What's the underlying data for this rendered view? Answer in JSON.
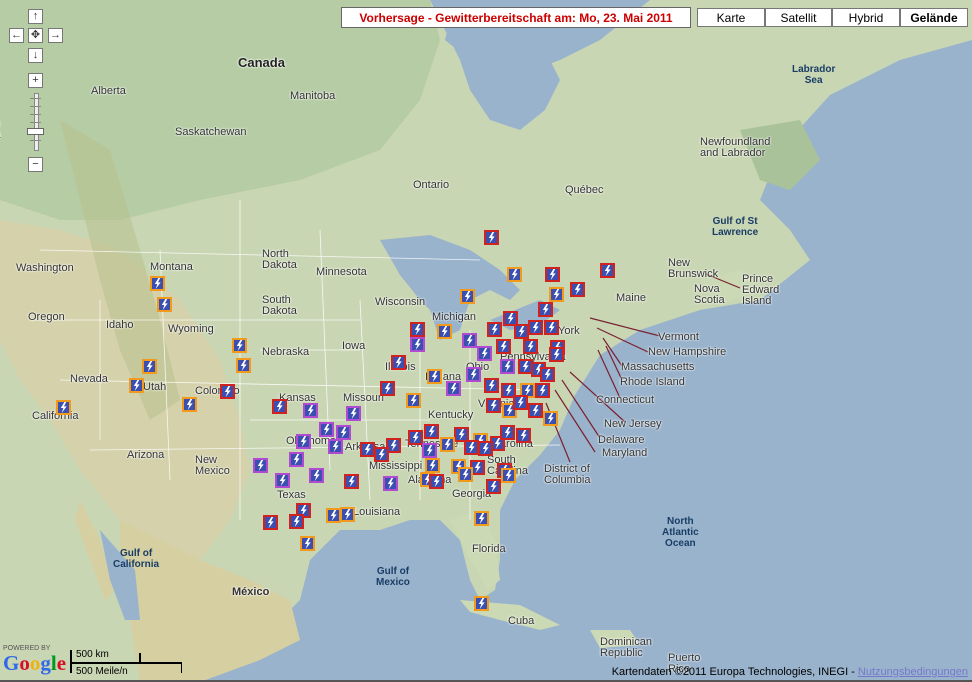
{
  "title": "Vorhersage - Gewitterbereitschaft am: Mo, 23. Mai 2011",
  "map_types": [
    {
      "label": "Karte",
      "active": false
    },
    {
      "label": "Satellit",
      "active": false
    },
    {
      "label": "Hybrid",
      "active": false
    },
    {
      "label": "Gelände",
      "active": true
    }
  ],
  "nav_controls": {
    "pan_up": "↑",
    "pan_left": "←",
    "pan_center": "✥",
    "pan_right": "→",
    "pan_down": "↓",
    "zoom_in": "+",
    "zoom_out": "−"
  },
  "logo": {
    "powered_by": "POWERED BY",
    "letters": [
      "G",
      "o",
      "o",
      "g",
      "l",
      "e"
    ],
    "colors": [
      "#3369e8",
      "#d50f25",
      "#eeb211",
      "#3369e8",
      "#009925",
      "#d50f25"
    ]
  },
  "scale": {
    "metric": "500 km",
    "imperial": "500 Meile/n"
  },
  "attribution": {
    "text": "Kartendaten ©2011 Europa Technologies, INEGI - ",
    "link": "Nutzungsbedingungen"
  },
  "place_labels": [
    {
      "id": "canada",
      "text": "Canada",
      "kind": "big"
    },
    {
      "id": "alberta",
      "text": "Alberta"
    },
    {
      "id": "manitoba",
      "text": "Manitoba"
    },
    {
      "id": "saskatchewan",
      "text": "Saskatchewan"
    },
    {
      "id": "ontario",
      "text": "Ontario"
    },
    {
      "id": "quebec",
      "text": "Québec"
    },
    {
      "id": "labrador-sea",
      "text": "Labrador\nSea",
      "kind": "water"
    },
    {
      "id": "newfoundland",
      "text": "Newfoundland\nand Labrador"
    },
    {
      "id": "gulf-st-lawrence",
      "text": "Gulf of St\nLawrence",
      "kind": "water"
    },
    {
      "id": "new-brunswick",
      "text": "New\nBrunswick"
    },
    {
      "id": "nova-scotia",
      "text": "Nova\nScotia"
    },
    {
      "id": "pei",
      "text": "Prince\nEdward\nIsland"
    },
    {
      "id": "washington",
      "text": "Washington"
    },
    {
      "id": "montana",
      "text": "Montana"
    },
    {
      "id": "north-dakota",
      "text": "North\nDakota"
    },
    {
      "id": "minnesota",
      "text": "Minnesota"
    },
    {
      "id": "maine",
      "text": "Maine"
    },
    {
      "id": "oregon",
      "text": "Oregon"
    },
    {
      "id": "idaho",
      "text": "Idaho"
    },
    {
      "id": "wyoming",
      "text": "Wyoming"
    },
    {
      "id": "south-dakota",
      "text": "South\nDakota"
    },
    {
      "id": "wisconsin",
      "text": "Wisconsin"
    },
    {
      "id": "michigan",
      "text": "Michigan"
    },
    {
      "id": "new-york",
      "text": "York"
    },
    {
      "id": "vermont",
      "text": "Vermont",
      "kind": "callout"
    },
    {
      "id": "new-hampshire",
      "text": "New Hampshire",
      "kind": "callout"
    },
    {
      "id": "massachusetts",
      "text": "Massachusetts",
      "kind": "callout"
    },
    {
      "id": "rhode-island",
      "text": "Rhode Island",
      "kind": "callout"
    },
    {
      "id": "connecticut",
      "text": "Connecticut",
      "kind": "callout"
    },
    {
      "id": "new-jersey",
      "text": "New Jersey",
      "kind": "callout"
    },
    {
      "id": "delaware",
      "text": "Delaware",
      "kind": "callout"
    },
    {
      "id": "maryland",
      "text": "Maryland",
      "kind": "callout"
    },
    {
      "id": "dc",
      "text": "District of\nColumbia",
      "kind": "callout"
    },
    {
      "id": "nevada",
      "text": "Nevada"
    },
    {
      "id": "utah",
      "text": "Utah"
    },
    {
      "id": "nebraska",
      "text": "Nebraska"
    },
    {
      "id": "iowa",
      "text": "Iowa"
    },
    {
      "id": "illinois",
      "text": "Illinois"
    },
    {
      "id": "indiana",
      "text": "Indiana"
    },
    {
      "id": "ohio",
      "text": "Ohio"
    },
    {
      "id": "pennsylvania",
      "text": "Pennsylvania"
    },
    {
      "id": "california",
      "text": "California"
    },
    {
      "id": "colorado",
      "text": "Colorado"
    },
    {
      "id": "kansas",
      "text": "Kansas"
    },
    {
      "id": "missouri",
      "text": "Missouri"
    },
    {
      "id": "kentucky",
      "text": "Kentucky"
    },
    {
      "id": "virginia",
      "text": "Virginia"
    },
    {
      "id": "arizona",
      "text": "Arizona"
    },
    {
      "id": "new-mexico",
      "text": "New\nMexico"
    },
    {
      "id": "oklahoma",
      "text": "Oklahoma"
    },
    {
      "id": "arkansas",
      "text": "Arkansas"
    },
    {
      "id": "tennessee",
      "text": "Tennessee"
    },
    {
      "id": "north-carolina",
      "text": "Carolina"
    },
    {
      "id": "south-carolina",
      "text": "South\nCarolina"
    },
    {
      "id": "mississippi",
      "text": "Mississippi"
    },
    {
      "id": "alabama",
      "text": "Alabama"
    },
    {
      "id": "georgia",
      "text": "Georgia"
    },
    {
      "id": "texas",
      "text": "Texas"
    },
    {
      "id": "louisiana",
      "text": "Louisiana"
    },
    {
      "id": "florida",
      "text": "Florida"
    },
    {
      "id": "north-atlantic",
      "text": "North\nAtlantic\nOcean",
      "kind": "water"
    },
    {
      "id": "gulf-california",
      "text": "Gulf of\nCalifornia",
      "kind": "water"
    },
    {
      "id": "mexico",
      "text": "México",
      "kind": "bold"
    },
    {
      "id": "gulf-mexico",
      "text": "Gulf of\nMexico",
      "kind": "water"
    },
    {
      "id": "cuba",
      "text": "Cuba"
    },
    {
      "id": "dominican",
      "text": "Dominican\nRepublic"
    },
    {
      "id": "puerto-rico",
      "text": "Puerto\nRico"
    },
    {
      "id": "left-edge-sk",
      "text": "ish\nbia"
    }
  ],
  "marker_counts": {
    "total": 104
  }
}
